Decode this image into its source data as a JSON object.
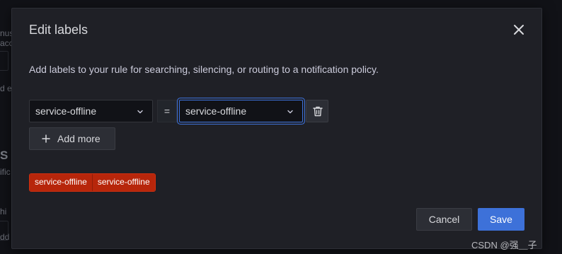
{
  "modal": {
    "title": "Edit labels",
    "description": "Add labels to your rule for searching, silencing, or routing to a notification policy."
  },
  "label_row": {
    "key_value": "service-offline",
    "operator": "=",
    "value_value": "service-offline"
  },
  "add_more_label": "Add more",
  "preview_tag": {
    "key": "service-offline",
    "value": "service-offline"
  },
  "footer": {
    "cancel_label": "Cancel",
    "save_label": "Save"
  },
  "watermark": "CSDN @强＿子",
  "background_fragments": [
    "nus",
    "acc",
    "d e",
    "S",
    "ific",
    "hi",
    "dd"
  ],
  "colors": {
    "primary": "#3d71d9",
    "tag_red": "#b7260b",
    "modal_bg": "#1f2026"
  },
  "icons": [
    "close-icon",
    "chevron-down-icon",
    "trash-icon",
    "plus-icon"
  ]
}
